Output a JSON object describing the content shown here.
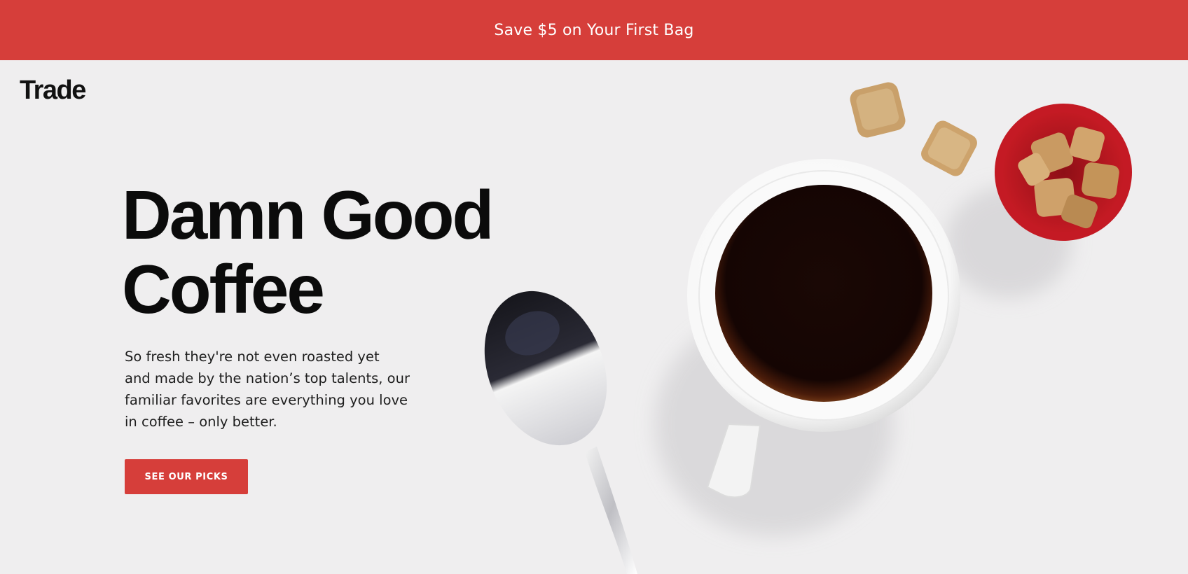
{
  "banner": {
    "text": "Save $5 on Your First Bag"
  },
  "header": {
    "logo": "Trade"
  },
  "hero": {
    "headline_line1": "Damn Good",
    "headline_line2": "Coffee",
    "description_lines": [
      "So fresh they're not even roasted yet",
      "and made by the nation’s top talents, our",
      "familiar favorites are everything you love",
      "in coffee – only better."
    ],
    "cta_label": "SEE OUR PICKS"
  },
  "colors": {
    "accent": "#d63e3a",
    "background": "#efeeef",
    "text": "#0b0b0b"
  },
  "imagery": {
    "items": [
      "coffee-cup-icon",
      "spoon-icon",
      "sugar-cube-icon",
      "sugar-bowl-icon"
    ]
  }
}
